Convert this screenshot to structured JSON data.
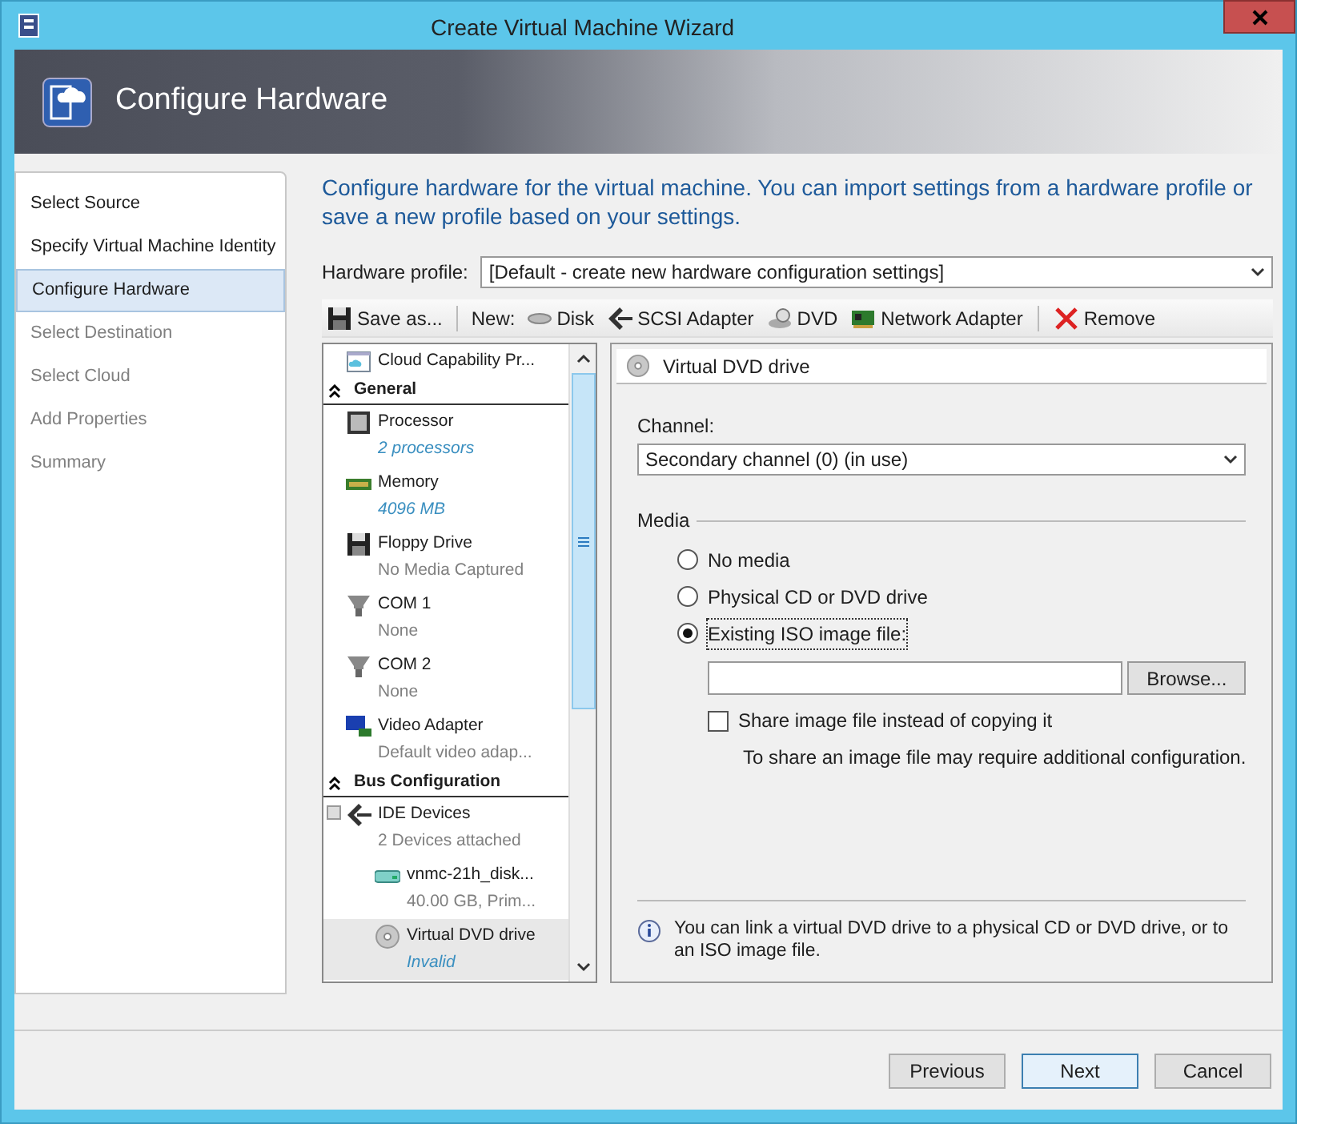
{
  "window": {
    "title": "Create Virtual Machine Wizard"
  },
  "header": {
    "title": "Configure Hardware"
  },
  "nav": [
    {
      "label": "Select Source",
      "selected": false,
      "disabled": false
    },
    {
      "label": "Specify Virtual Machine Identity",
      "selected": false,
      "disabled": false
    },
    {
      "label": "Configure Hardware",
      "selected": true,
      "disabled": false
    },
    {
      "label": "Select Destination",
      "selected": false,
      "disabled": true
    },
    {
      "label": "Select Cloud",
      "selected": false,
      "disabled": true
    },
    {
      "label": "Add Properties",
      "selected": false,
      "disabled": true
    },
    {
      "label": "Summary",
      "selected": false,
      "disabled": true
    }
  ],
  "description": "Configure hardware for the virtual machine. You can import settings from a hardware profile or save a new profile based on your settings.",
  "hardware_profile": {
    "label": "Hardware profile:",
    "value": "[Default - create new hardware configuration settings]"
  },
  "toolbar": [
    {
      "kind": "button",
      "label": "Save as...",
      "separator_before": false
    },
    {
      "kind": "label",
      "label": "New:",
      "separator_before": true
    },
    {
      "kind": "button",
      "label": "Disk",
      "separator_before": false
    },
    {
      "kind": "button",
      "label": "SCSI Adapter",
      "separator_before": false
    },
    {
      "kind": "button",
      "label": "DVD",
      "separator_before": false
    },
    {
      "kind": "button",
      "label": "Network Adapter",
      "separator_before": false
    },
    {
      "kind": "button",
      "label": "Remove",
      "separator_before": true
    }
  ],
  "tree": [
    {
      "kind": "item",
      "name": "Cloud Capability Pr...",
      "selected": false
    },
    {
      "kind": "section",
      "name": "General",
      "expanded": true
    },
    {
      "kind": "item",
      "name": "Processor",
      "detail": "2 processors",
      "emphasized": true,
      "selected": false
    },
    {
      "kind": "item",
      "name": "Memory",
      "detail": "4096 MB",
      "emphasized": true,
      "selected": false
    },
    {
      "kind": "item",
      "name": "Floppy Drive",
      "detail": "No Media Captured",
      "emphasized": false,
      "selected": false
    },
    {
      "kind": "item",
      "name": "COM 1",
      "detail": "None",
      "emphasized": false,
      "selected": false
    },
    {
      "kind": "item",
      "name": "COM 2",
      "detail": "None",
      "emphasized": false,
      "selected": false
    },
    {
      "kind": "item",
      "name": "Video Adapter",
      "detail": "Default video adap...",
      "emphasized": false,
      "selected": false
    },
    {
      "kind": "section",
      "name": "Bus Configuration",
      "expanded": true
    },
    {
      "kind": "item",
      "name": "IDE Devices",
      "detail": "2 Devices attached",
      "emphasized": false,
      "selected": false,
      "expanded": true,
      "children": [
        {
          "kind": "item",
          "name": "vnmc-21h_disk...",
          "detail": "40.00 GB, Prim...",
          "emphasized": false,
          "selected": false
        },
        {
          "kind": "item",
          "name": "Virtual DVD drive",
          "detail": "Invalid",
          "emphasized": true,
          "selected": true
        }
      ]
    }
  ],
  "detail_pane": {
    "title": "Virtual DVD drive",
    "channel": {
      "label": "Channel:",
      "value": "Secondary channel (0) (in use)"
    },
    "media": {
      "label": "Media",
      "options": [
        {
          "label": "No media",
          "selected": false
        },
        {
          "label": "Physical CD or DVD drive",
          "selected": false
        },
        {
          "label": "Existing ISO image file:",
          "selected": true
        }
      ]
    },
    "browse_button": "Browse...",
    "share": {
      "label": "Share image file instead of copying it",
      "checked": false
    },
    "share_note": "To share an image file may require additional configuration.",
    "info": "You can link a virtual DVD drive to a physical CD or DVD drive, or to an ISO image file."
  },
  "buttons": [
    {
      "label": "Previous",
      "default": false
    },
    {
      "label": "Next",
      "default": true
    },
    {
      "label": "Cancel",
      "default": false
    }
  ]
}
